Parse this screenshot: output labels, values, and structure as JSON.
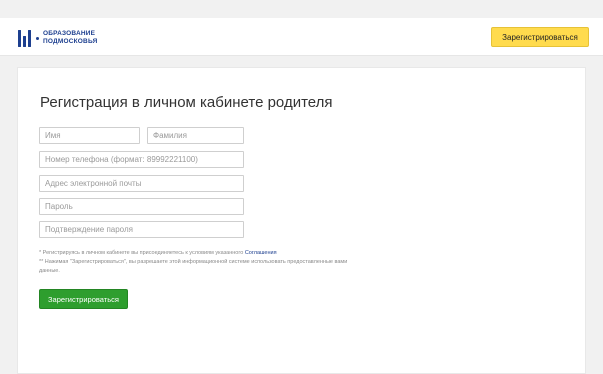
{
  "header": {
    "logo_icon": "mosreg-bars-logo-icon",
    "logo_line1": "ОБРАЗОВАНИЕ",
    "logo_line2": "ПОДМОСКОВЬЯ",
    "register_label": "Зарегистрироваться",
    "accent_color": "#ffdb4d",
    "brand_color": "#1d3f8f"
  },
  "form": {
    "title": "Регистрация в личном кабинете родителя",
    "fields": {
      "first_name": {
        "placeholder": "Имя",
        "value": ""
      },
      "last_name": {
        "placeholder": "Фамилия",
        "value": ""
      },
      "phone": {
        "placeholder": "Номер телефона (формат: 89992221100)",
        "value": ""
      },
      "email": {
        "placeholder": "Адрес электронной почты",
        "value": ""
      },
      "password": {
        "placeholder": "Пароль",
        "value": ""
      },
      "password_confirm": {
        "placeholder": "Подтверждение пароля",
        "value": ""
      }
    },
    "note1_prefix": "* Регистрируясь в личном кабинете вы присоединяетесь к условиям указанного ",
    "note1_link": "Соглашения",
    "note2": "** Нажимая \"Зарегистрироваться\", вы разрешаете этой информационной системе использовать предоставленные вами данные.",
    "submit_label": "Зарегистрироваться",
    "submit_color": "#2e9e2e"
  }
}
